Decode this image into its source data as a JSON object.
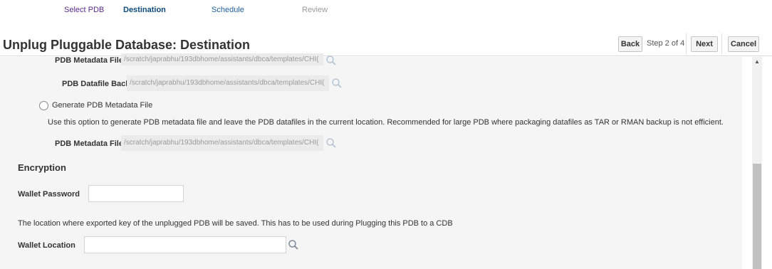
{
  "train": {
    "steps": [
      {
        "label": "Select PDB"
      },
      {
        "label": "Destination"
      },
      {
        "label": "Schedule"
      },
      {
        "label": "Review"
      }
    ]
  },
  "header": {
    "title": "Unplug Pluggable Database: Destination",
    "back_label": "Back",
    "step_indicator": "Step 2 of 4",
    "next_label": "Next",
    "cancel_label": "Cancel"
  },
  "form": {
    "pdb_metadata_file_label": "PDB Metadata File",
    "pdb_metadata_file_value": "/scratch/japrabhu/193dbhome/assistants/dbca/templates/CHI(",
    "pdb_datafile_backup_label": "PDB Datafile Backup",
    "pdb_datafile_backup_value": "/scratch/japrabhu/193dbhome/assistants/dbca/templates/CHI(",
    "generate_option_label": "Generate PDB Metadata File",
    "generate_option_description": "Use this option to generate PDB metadata file and leave the PDB datafiles in the current location. Recommended for large PDB where packaging datafiles as TAR or RMAN backup is not efficient.",
    "generate_metadata_file_label": "PDB Metadata File",
    "generate_metadata_file_value": "/scratch/japrabhu/193dbhome/assistants/dbca/templates/CHI(",
    "encryption_title": "Encryption",
    "wallet_password_label": "Wallet Password",
    "wallet_password_value": "",
    "wallet_location_note": "The location where exported key of the unplugged PDB will be saved. This has to be used during Plugging this PDB to a CDB",
    "wallet_location_label": "Wallet Location",
    "wallet_location_value": ""
  },
  "icons": {
    "search": "search-icon",
    "scroll_up": "scroll-up-arrow-icon"
  },
  "colors": {
    "visited_step": "#5b2a8c",
    "current_step": "#0c4a7a",
    "content_background": "#f5f5f5"
  }
}
